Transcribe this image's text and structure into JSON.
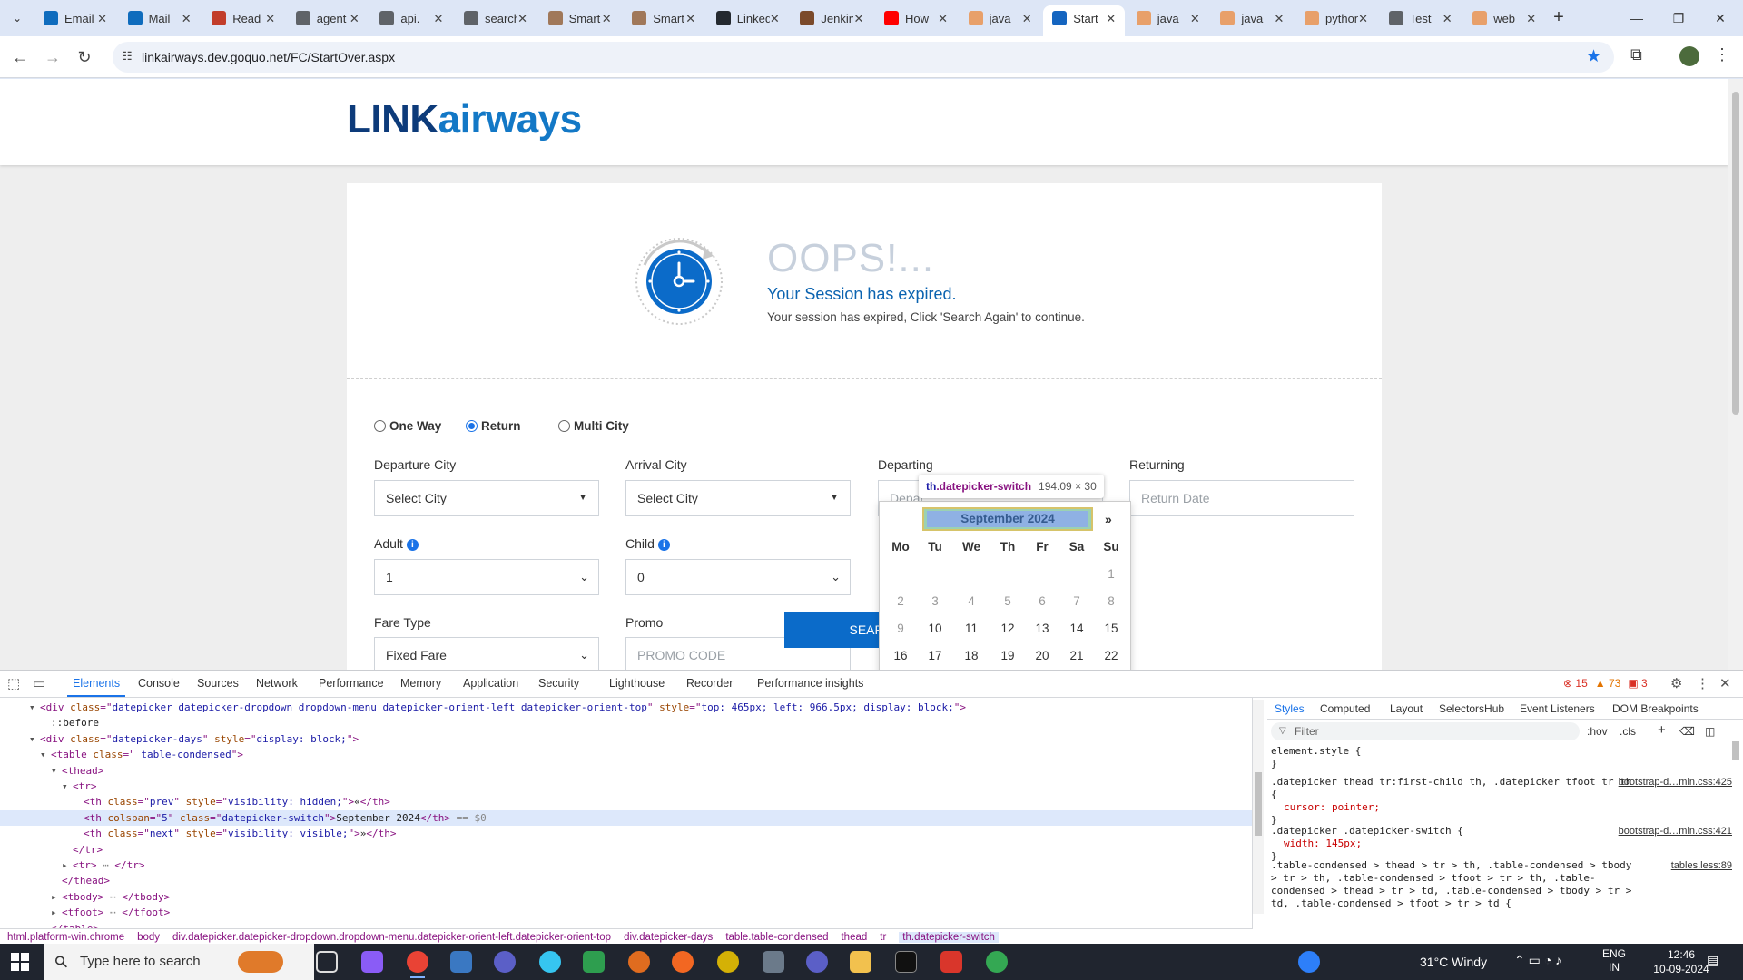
{
  "browser": {
    "tabs": [
      {
        "title": "Email",
        "color": "#0f6cbd"
      },
      {
        "title": "Mail",
        "color": "#0f6cbd"
      },
      {
        "title": "Read",
        "color": "#c23d2a"
      },
      {
        "title": "agent",
        "color": "#5f6368"
      },
      {
        "title": "api.",
        "color": "#5f6368"
      },
      {
        "title": "search",
        "color": "#5f6368"
      },
      {
        "title": "Smart",
        "color": "#a0785a"
      },
      {
        "title": "Smart",
        "color": "#a0785a"
      },
      {
        "title": "LinkedIn",
        "color": "#24292f"
      },
      {
        "title": "Jenkins",
        "color": "#7b4a2b"
      },
      {
        "title": "How",
        "color": "#ff0000"
      },
      {
        "title": "java",
        "color": "#e8a06a"
      },
      {
        "title": "Start",
        "color": "#1565c0",
        "active": true
      },
      {
        "title": "java",
        "color": "#e8a06a"
      },
      {
        "title": "java",
        "color": "#e8a06a"
      },
      {
        "title": "python",
        "color": "#e8a06a"
      },
      {
        "title": "Test",
        "color": "#5f6368"
      },
      {
        "title": "web",
        "color": "#e8a06a"
      }
    ],
    "url": "linkairways.dev.goquo.net/FC/StartOver.aspx"
  },
  "page": {
    "logo": {
      "part1": "LIN",
      "part2": "K",
      "part3": "airways"
    },
    "oops_title": "OOPS!...",
    "expired_heading": "Your Session has expired.",
    "expired_message": "Your session has expired, Click 'Search Again' to continue.",
    "trip_types": [
      {
        "label": "One Way",
        "selected": false
      },
      {
        "label": "Return",
        "selected": true
      },
      {
        "label": "Multi City",
        "selected": false
      }
    ],
    "departure_city": {
      "label": "Departure City",
      "value": "Select City"
    },
    "arrival_city": {
      "label": "Arrival City",
      "value": "Select City"
    },
    "departing": {
      "label": "Departing",
      "placeholder": "Depar"
    },
    "returning": {
      "label": "Returning",
      "placeholder": "Return Date"
    },
    "adult": {
      "label": "Adult",
      "value": "1"
    },
    "child": {
      "label": "Child",
      "value": "0"
    },
    "fare_type": {
      "label": "Fare Type",
      "value": "Fixed Fare"
    },
    "promo": {
      "label": "Promo",
      "placeholder": "PROMO CODE"
    },
    "search_again_label": "SEARCH AGAIN",
    "accent_color": "#0b6bc9"
  },
  "datepicker": {
    "month_label": "September 2024",
    "next_label": "»",
    "weekdays": [
      "Mo",
      "Tu",
      "We",
      "Th",
      "Fr",
      "Sa",
      "Su"
    ],
    "weeks": [
      [
        "",
        "",
        "",
        "",
        "",
        "",
        "1"
      ],
      [
        "2",
        "3",
        "4",
        "5",
        "6",
        "7",
        "8"
      ],
      [
        "9",
        "10",
        "11",
        "12",
        "13",
        "14",
        "15"
      ],
      [
        "16",
        "17",
        "18",
        "19",
        "20",
        "21",
        "22"
      ]
    ]
  },
  "inspect_tooltip": {
    "tag": "th",
    "class": ".datepicker-switch",
    "size": "194.09 × 30"
  },
  "devtools": {
    "tabs": [
      "Elements",
      "Console",
      "Sources",
      "Network",
      "Performance",
      "Memory",
      "Application",
      "Security",
      "Lighthouse",
      "Recorder",
      "Performance insights"
    ],
    "errors": "15",
    "warnings": "73",
    "issues": "3",
    "dom_lines": [
      {
        "indent": 2,
        "tri": "▾",
        "html": "<span class=\"tg\">&lt;div</span> <span class=\"an\">class</span>=\"<span class=\"av\">datepicker datepicker-dropdown dropdown-menu datepicker-orient-left datepicker-orient-top</span>\" <span class=\"an\">style</span>=\"<span class=\"av\">top: 465px; left: 966.5px; display: block;</span>\"<span class=\"tg\">&gt;</span>"
      },
      {
        "indent": 3,
        "tri": "",
        "html": "<span class=\"tx\">::before</span>"
      },
      {
        "indent": 2,
        "tri": "▾",
        "html": "<span class=\"tg\">&lt;div</span> <span class=\"an\">class</span>=\"<span class=\"av\">datepicker-days</span>\" <span class=\"an\">style</span>=\"<span class=\"av\">display: block;</span>\"<span class=\"tg\">&gt;</span>"
      },
      {
        "indent": 3,
        "tri": "▾",
        "html": "<span class=\"tg\">&lt;table</span> <span class=\"an\">class</span>=\"<span class=\"av\"> table-condensed</span>\"<span class=\"tg\">&gt;</span>"
      },
      {
        "indent": 4,
        "tri": "▾",
        "html": "<span class=\"tg\">&lt;thead&gt;</span>"
      },
      {
        "indent": 5,
        "tri": "▾",
        "html": "<span class=\"tg\">&lt;tr&gt;</span>"
      },
      {
        "indent": 6,
        "tri": "",
        "html": "<span class=\"tg\">&lt;th</span> <span class=\"an\">class</span>=\"<span class=\"av\">prev</span>\" <span class=\"an\">style</span>=\"<span class=\"av\">visibility: hidden;</span>\"<span class=\"tg\">&gt;</span><span class=\"tx\">«</span><span class=\"tg\">&lt;/th&gt;</span>"
      },
      {
        "indent": 6,
        "tri": "",
        "sel": true,
        "html": "<span class=\"tg\">&lt;th</span> <span class=\"an\">colspan</span>=\"<span class=\"av\">5</span>\" <span class=\"an\">class</span>=\"<span class=\"av\">datepicker-switch</span>\"<span class=\"tg\">&gt;</span><span class=\"tx\">September 2024</span><span class=\"tg\">&lt;/th&gt;</span> <span class=\"cm\">== $0</span>"
      },
      {
        "indent": 6,
        "tri": "",
        "html": "<span class=\"tg\">&lt;th</span> <span class=\"an\">class</span>=\"<span class=\"av\">next</span>\" <span class=\"an\">style</span>=\"<span class=\"av\">visibility: visible;</span>\"<span class=\"tg\">&gt;</span><span class=\"tx\">»</span><span class=\"tg\">&lt;/th&gt;</span>"
      },
      {
        "indent": 5,
        "tri": "",
        "html": "<span class=\"tg\">&lt;/tr&gt;</span>"
      },
      {
        "indent": 5,
        "tri": "▸",
        "html": "<span class=\"tg\">&lt;tr&gt;</span> <span class=\"cm\">⋯</span> <span class=\"tg\">&lt;/tr&gt;</span>"
      },
      {
        "indent": 4,
        "tri": "",
        "html": "<span class=\"tg\">&lt;/thead&gt;</span>"
      },
      {
        "indent": 4,
        "tri": "▸",
        "html": "<span class=\"tg\">&lt;tbody&gt;</span> <span class=\"cm\">⋯</span> <span class=\"tg\">&lt;/tbody&gt;</span>"
      },
      {
        "indent": 4,
        "tri": "▸",
        "html": "<span class=\"tg\">&lt;tfoot&gt;</span> <span class=\"cm\">⋯</span> <span class=\"tg\">&lt;/tfoot&gt;</span>"
      },
      {
        "indent": 3,
        "tri": "",
        "html": "<span class=\"tg\">&lt;/table&gt;</span>"
      }
    ],
    "breadcrumbs": [
      "html.platform-win.chrome",
      "body",
      "div.datepicker.datepicker-dropdown.dropdown-menu.datepicker-orient-left.datepicker-orient-top",
      "div.datepicker-days",
      "table.table-condensed",
      "thead",
      "tr",
      "th.datepicker-switch"
    ],
    "styles_tabs": [
      "Styles",
      "Computed",
      "Layout",
      "SelectorsHub",
      "Event Listeners",
      "DOM Breakpoints"
    ],
    "filter_placeholder": "Filter",
    "hov_label": ":hov",
    "cls_label": ".cls",
    "rules": [
      {
        "selector": "element.style {",
        "props": [],
        "close": "}",
        "src": ""
      },
      {
        "selector": ".datepicker thead tr:first-child th, .datepicker tfoot tr th {",
        "props": [
          "cursor: pointer;"
        ],
        "close": "}",
        "src": "bootstrap-d…min.css:425"
      },
      {
        "selector": ".datepicker .datepicker-switch {",
        "props": [
          "width: 145px;"
        ],
        "close": "}",
        "src": "bootstrap-d…min.css:421"
      },
      {
        "selector": ".table-condensed > thead > tr > th, .table-condensed > tbody > tr > th, .table-condensed > tfoot > tr > th, .table-condensed > thead > tr > td, .table-condensed > tbody > tr > td, .table-condensed > tfoot > tr > td {",
        "props": [],
        "close": "",
        "src": "tables.less:89"
      }
    ]
  },
  "taskbar": {
    "search_placeholder": "Type here to search",
    "weather": "31°C  Windy",
    "lang_line1": "ENG",
    "lang_line2": "IN",
    "time": "12:46",
    "date": "10-09-2024",
    "notif_count": "1"
  }
}
